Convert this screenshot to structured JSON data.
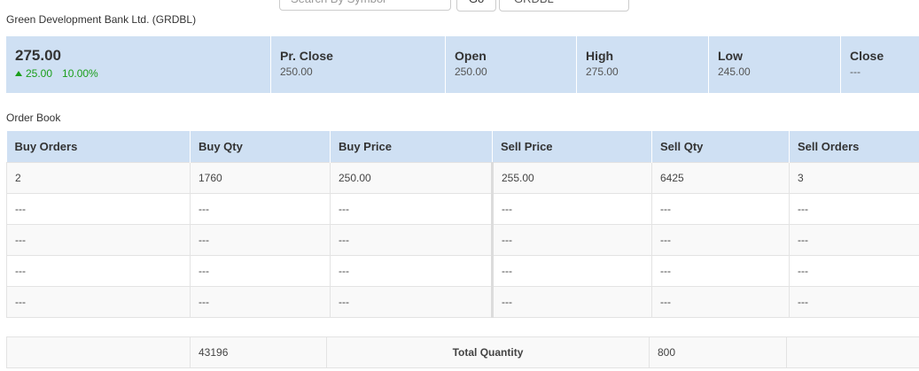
{
  "search": {
    "placeholder": "Search By Symbol",
    "go_label": "Go",
    "selected_symbol": "GRDBL"
  },
  "company": {
    "name": "Green Development Bank Ltd. (GRDBL)"
  },
  "summary": {
    "ltp": "275.00",
    "change": "25.00",
    "change_pct": "10.00%",
    "trend_color": "#1a9e1a",
    "stats": [
      {
        "label": "Pr. Close",
        "value": "250.00"
      },
      {
        "label": "Open",
        "value": "250.00"
      },
      {
        "label": "High",
        "value": "275.00"
      },
      {
        "label": "Low",
        "value": "245.00"
      },
      {
        "label": "Close",
        "value": "---"
      }
    ]
  },
  "order_book": {
    "title": "Order Book",
    "columns": [
      "Buy Orders",
      "Buy Qty",
      "Buy Price",
      "Sell Price",
      "Sell Qty",
      "Sell Orders"
    ],
    "rows": [
      [
        "2",
        "1760",
        "250.00",
        "255.00",
        "6425",
        "3"
      ],
      [
        "---",
        "---",
        "---",
        "---",
        "---",
        "---"
      ],
      [
        "---",
        "---",
        "---",
        "---",
        "---",
        "---"
      ],
      [
        "---",
        "---",
        "---",
        "---",
        "---",
        "---"
      ],
      [
        "---",
        "---",
        "---",
        "---",
        "---",
        "---"
      ]
    ],
    "totals": {
      "buy_qty": "43196",
      "label": "Total Quantity",
      "sell_qty": "800"
    }
  },
  "colors": {
    "header_bg": "#cfe0f3",
    "up": "#1a9e1a"
  }
}
